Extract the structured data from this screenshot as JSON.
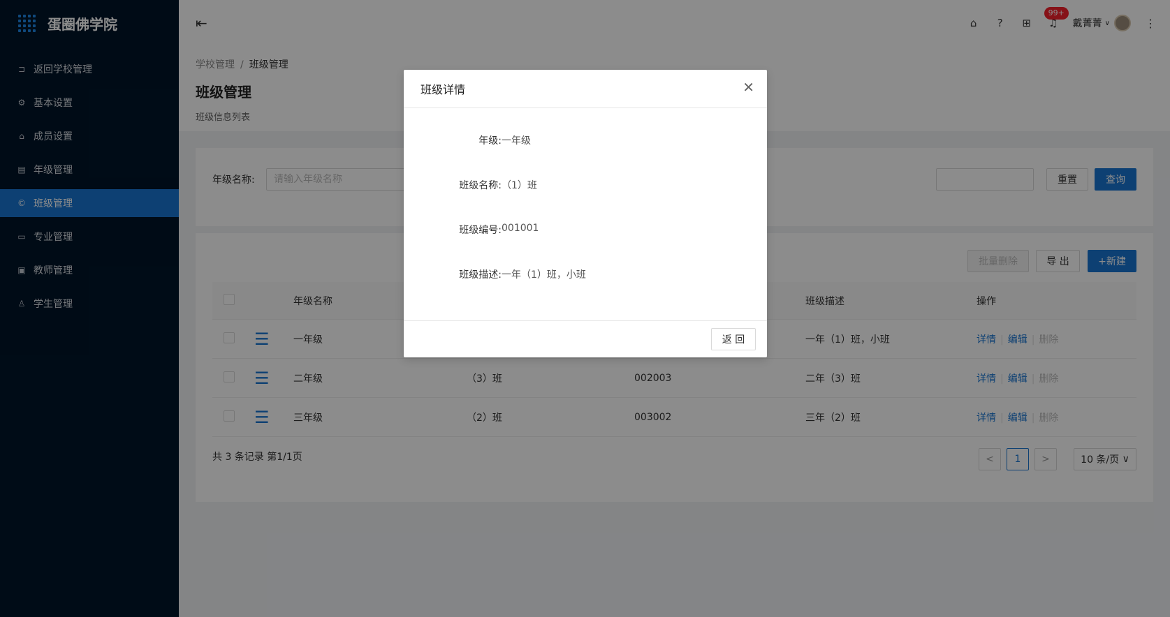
{
  "brand": {
    "title": "蛋圈佛学院"
  },
  "sidebar": {
    "items": [
      {
        "label": "返回学校管理",
        "icon": "exit-icon",
        "glyph": "⊐"
      },
      {
        "label": "基本设置",
        "icon": "gear-icon",
        "glyph": "⚙"
      },
      {
        "label": "成员设置",
        "icon": "home-icon",
        "glyph": "⌂"
      },
      {
        "label": "年级管理",
        "icon": "building-icon",
        "glyph": "▤"
      },
      {
        "label": "班级管理",
        "icon": "copyright-icon",
        "glyph": "©"
      },
      {
        "label": "专业管理",
        "icon": "laptop-icon",
        "glyph": "▭"
      },
      {
        "label": "教师管理",
        "icon": "idcard-icon",
        "glyph": "▣"
      },
      {
        "label": "学生管理",
        "icon": "user-icon",
        "glyph": "♙"
      }
    ],
    "active_index": 4
  },
  "header": {
    "badge": "99+",
    "username": "戴菁菁"
  },
  "breadcrumb": {
    "parent": "学校管理",
    "separator": "/",
    "current": "班级管理"
  },
  "page": {
    "title": "班级管理",
    "subtitle": "班级信息列表"
  },
  "search": {
    "label": "年级名称:",
    "placeholder": "请输入年级名称",
    "reset_label": "重置",
    "query_label": "查询"
  },
  "toolbar": {
    "batch_delete_label": "批量删除",
    "export_label": "导 出",
    "new_label": "+新建"
  },
  "table": {
    "columns": [
      "年级名称",
      "",
      "",
      "班级描述",
      "操作"
    ],
    "rows": [
      {
        "grade": "一年级",
        "name": "",
        "code": "",
        "desc": "一年（1）班，小班"
      },
      {
        "grade": "二年级",
        "name": "（3）班",
        "code": "002003",
        "desc": "二年（3）班"
      },
      {
        "grade": "三年级",
        "name": "（2）班",
        "code": "003002",
        "desc": "三年（2）班"
      }
    ],
    "ops": {
      "detail": "详情",
      "edit": "编辑",
      "delete": "删除"
    }
  },
  "pagination": {
    "total_text": "共 3 条记录 第1/1页",
    "prev": "<",
    "page": "1",
    "next": ">",
    "size": "10 条/页"
  },
  "modal": {
    "title": "班级详情",
    "fields": [
      {
        "label": "年级:",
        "value": "一年级"
      },
      {
        "label": "班级名称:",
        "value": "（1）班"
      },
      {
        "label": "班级编号:",
        "value": "001001"
      },
      {
        "label": "班级描述:",
        "value": "一年（1）班，小班"
      }
    ],
    "back_label": "返 回"
  },
  "colors": {
    "primary": "#1976d2",
    "sidebar_bg": "#001529",
    "badge": "#f5222d"
  }
}
